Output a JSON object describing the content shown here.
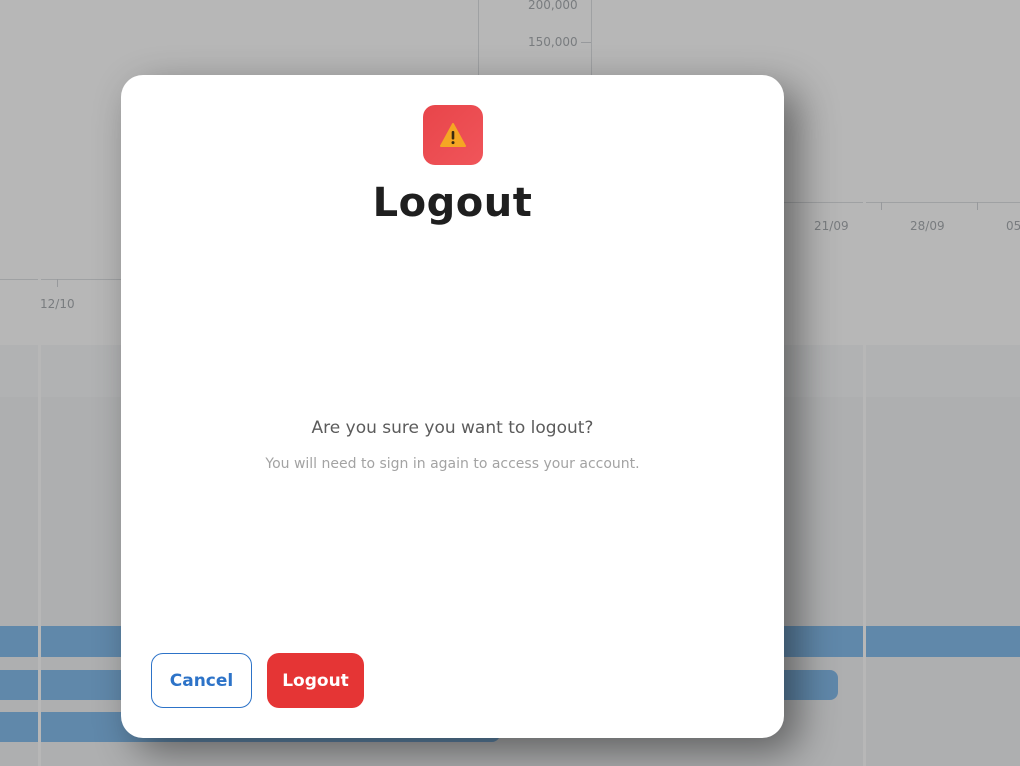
{
  "background": {
    "y_axis_labels": [
      "200,000",
      "150,000"
    ],
    "x_axis_labels_right": [
      "21/09",
      "28/09",
      "05"
    ],
    "x_axis_label_left": "12/10"
  },
  "modal": {
    "icon": "warning-icon",
    "icon_glyph": "⚠️",
    "title": "Logout",
    "question": "Are you sure you want to logout?",
    "hint": "You will need to sign in again to access your account.",
    "cancel_label": "Cancel",
    "logout_label": "Logout"
  },
  "colors": {
    "danger": "#e53535",
    "primary": "#2d73c8",
    "title": "#1f1f1f",
    "overlay": "rgba(95,95,95,0.45)"
  }
}
